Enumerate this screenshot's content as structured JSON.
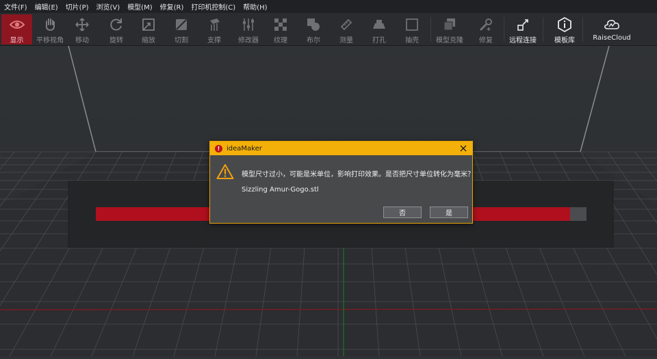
{
  "menu": [
    {
      "label": "文件(F)"
    },
    {
      "label": "编辑(E)"
    },
    {
      "label": "切片(P)"
    },
    {
      "label": "浏览(V)"
    },
    {
      "label": "模型(M)"
    },
    {
      "label": "修复(R)"
    },
    {
      "label": "打印机控制(C)"
    },
    {
      "label": "帮助(H)"
    }
  ],
  "toolbar": {
    "items": [
      {
        "label": "显示",
        "icon": "eye-icon"
      },
      {
        "label": "平移视角",
        "icon": "hand-icon"
      },
      {
        "label": "移动",
        "icon": "move-icon"
      },
      {
        "label": "旋转",
        "icon": "rotate-icon"
      },
      {
        "label": "缩放",
        "icon": "scale-icon"
      },
      {
        "label": "切割",
        "icon": "cut-icon"
      },
      {
        "label": "支撑",
        "icon": "support-icon"
      },
      {
        "label": "修改器",
        "icon": "modifier-icon"
      },
      {
        "label": "纹理",
        "icon": "texture-icon"
      },
      {
        "label": "布尔",
        "icon": "boolean-icon"
      },
      {
        "label": "测量",
        "icon": "measure-icon"
      },
      {
        "label": "打孔",
        "icon": "hole-icon"
      },
      {
        "label": "抽壳",
        "icon": "shell-icon"
      },
      {
        "label": "模型克隆",
        "icon": "clone-icon"
      },
      {
        "label": "修复",
        "icon": "repair-icon"
      },
      {
        "label": "远程连接",
        "icon": "remote-connect-icon"
      },
      {
        "label": "模板库",
        "icon": "template-library-icon"
      },
      {
        "label": "RaiseCloud",
        "icon": "cloud-icon"
      }
    ]
  },
  "colors": {
    "accent_red": "#8d1620",
    "dialog_title": "#f3b008",
    "model_red": "#b0101e"
  },
  "dialog": {
    "title": "ideaMaker",
    "message": "模型尺寸过小，可能是米单位，影响打印效果。是否把尺寸单位转化为毫米？",
    "filename": "Sizzling Amur-Gogo.stl",
    "no_label": "否",
    "yes_label": "是"
  }
}
